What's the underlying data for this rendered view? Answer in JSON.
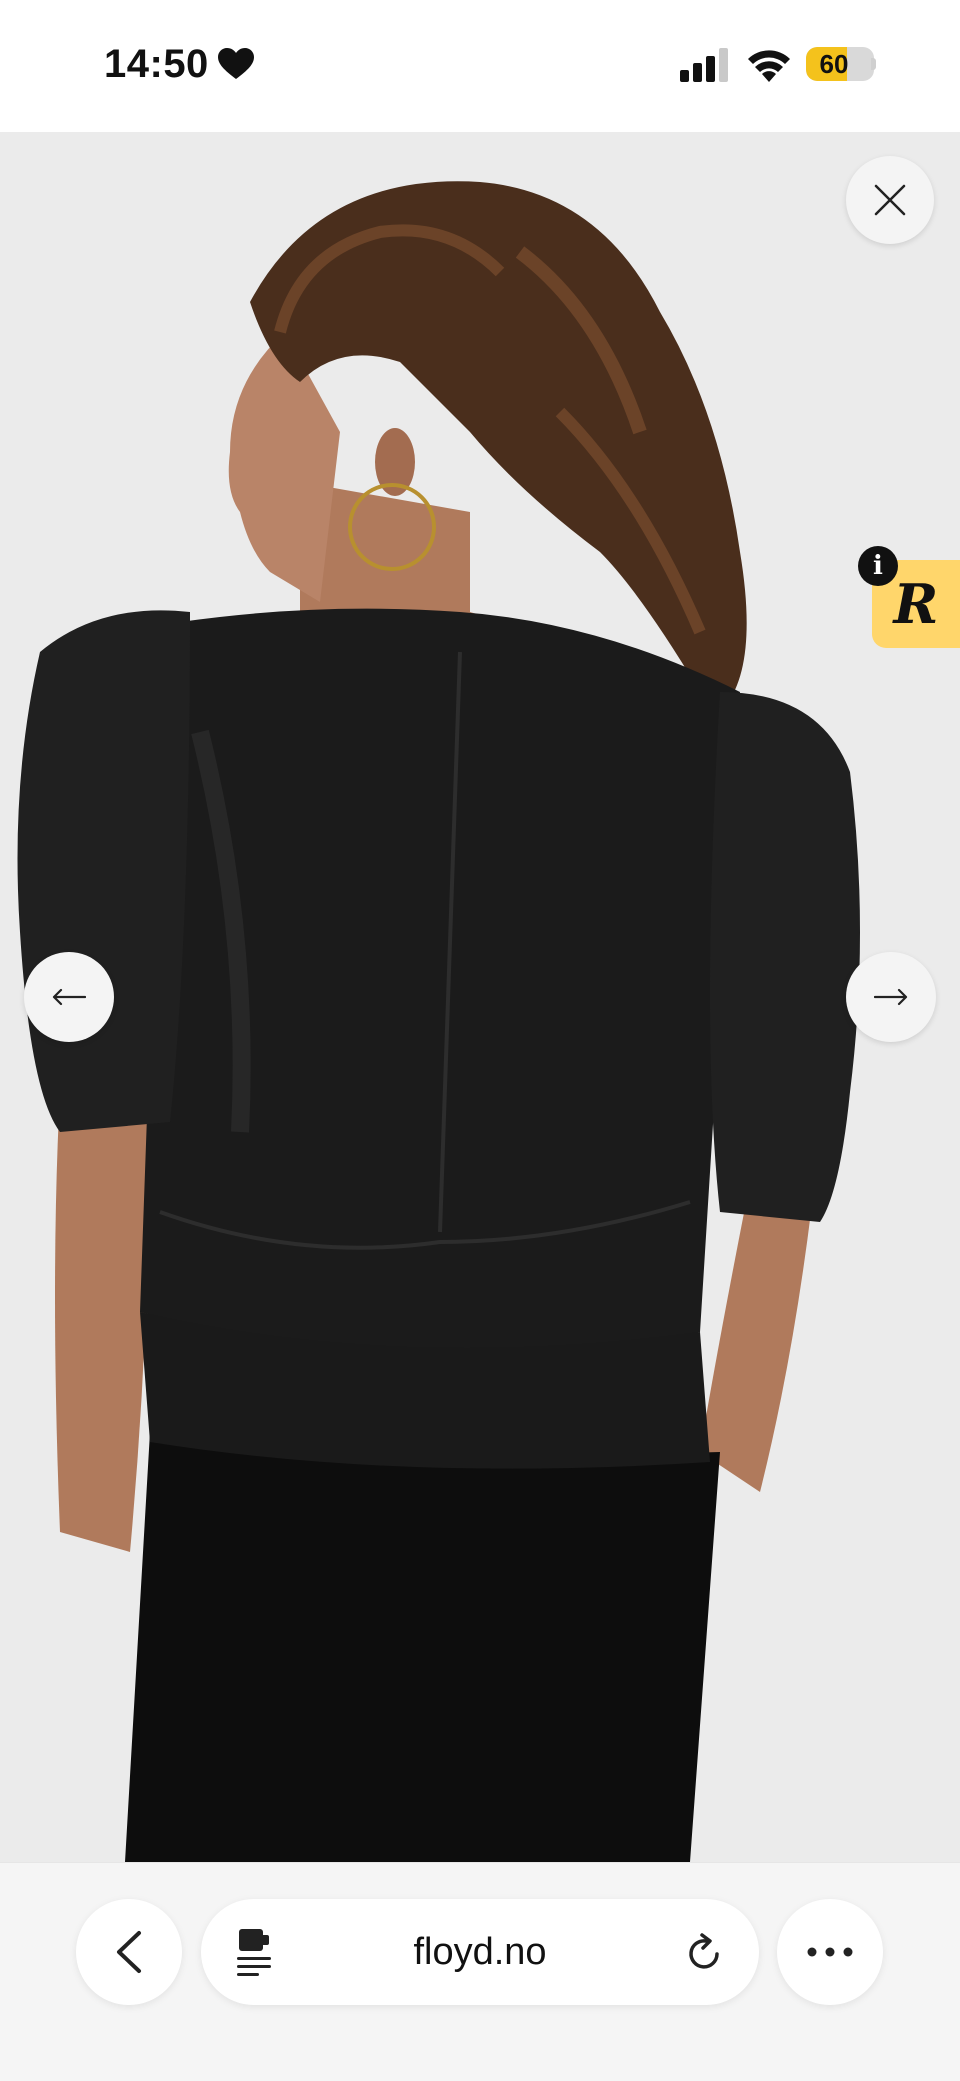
{
  "status_bar": {
    "time": "14:50",
    "battery_level": "60",
    "battery_fraction": 0.6,
    "heart_icon": "heart-icon",
    "signal_icon": "cellular-signal-icon",
    "wifi_icon": "wifi-icon"
  },
  "gallery": {
    "close_icon": "close-icon",
    "prev_icon": "arrow-left-icon",
    "next_icon": "arrow-right-icon",
    "background_color": "#ebebeb"
  },
  "extension_badge": {
    "info_glyph": "i",
    "letter": "R",
    "color": "#ffd66b"
  },
  "browser_bar": {
    "back_icon": "chevron-left-icon",
    "reader_icon": "reader-mode-icon",
    "url": "floyd.no",
    "reload_icon": "reload-icon",
    "more_icon": "more-dots-icon"
  }
}
